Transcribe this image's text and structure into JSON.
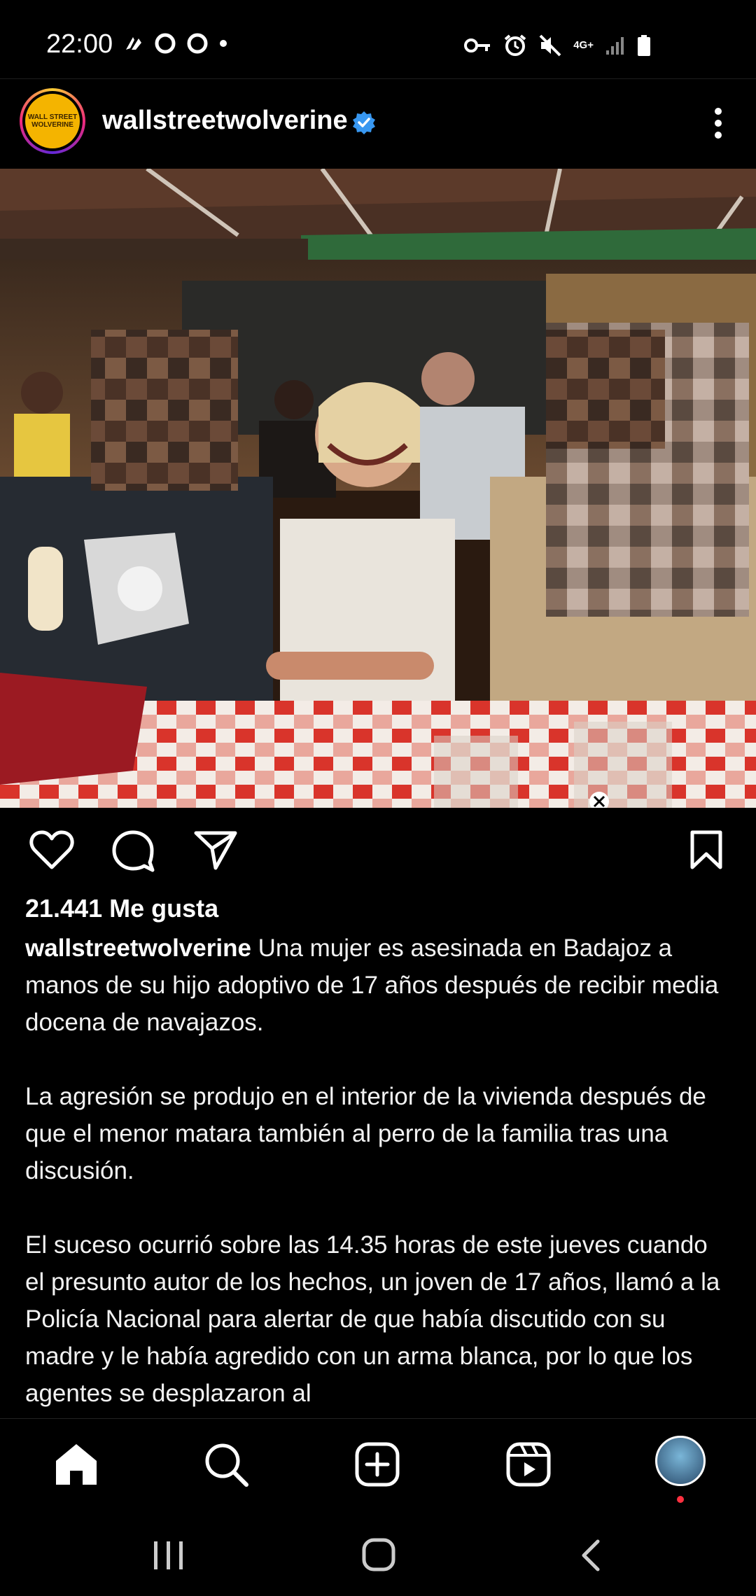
{
  "status": {
    "time": "22:00",
    "network_label": "4G+"
  },
  "post": {
    "username": "wallstreetwolverine",
    "avatar_text": "WALL STREET WOLVERINE",
    "likes": "21.441 Me gusta",
    "caption_user": "wallstreetwolverine",
    "caption_paragraphs": [
      "Una mujer es asesinada en Badajoz a manos de su hijo adoptivo de 17 años después de recibir media docena de navajazos.",
      "La agresión se produjo en el interior de la vivienda después de que el menor matara también al perro de la familia tras una discusión.",
      "El suceso ocurrió sobre las 14.35 horas de este jueves cuando el presunto autor de los hechos, un joven de 17 años, llamó a la Policía Nacional para alertar de que había discutido con su madre y le había agredido con un arma blanca, por lo que los agentes se desplazaron al"
    ]
  },
  "colors": {
    "background": "#000000",
    "verified_blue": "#3897f0",
    "notification_dot": "#ff3040"
  },
  "icons": {
    "like": "heart-icon",
    "comment": "comment-icon",
    "share": "send-icon",
    "save": "bookmark-icon",
    "nav": [
      "home-icon",
      "search-icon",
      "create-icon",
      "reels-icon",
      "profile-avatar"
    ]
  }
}
